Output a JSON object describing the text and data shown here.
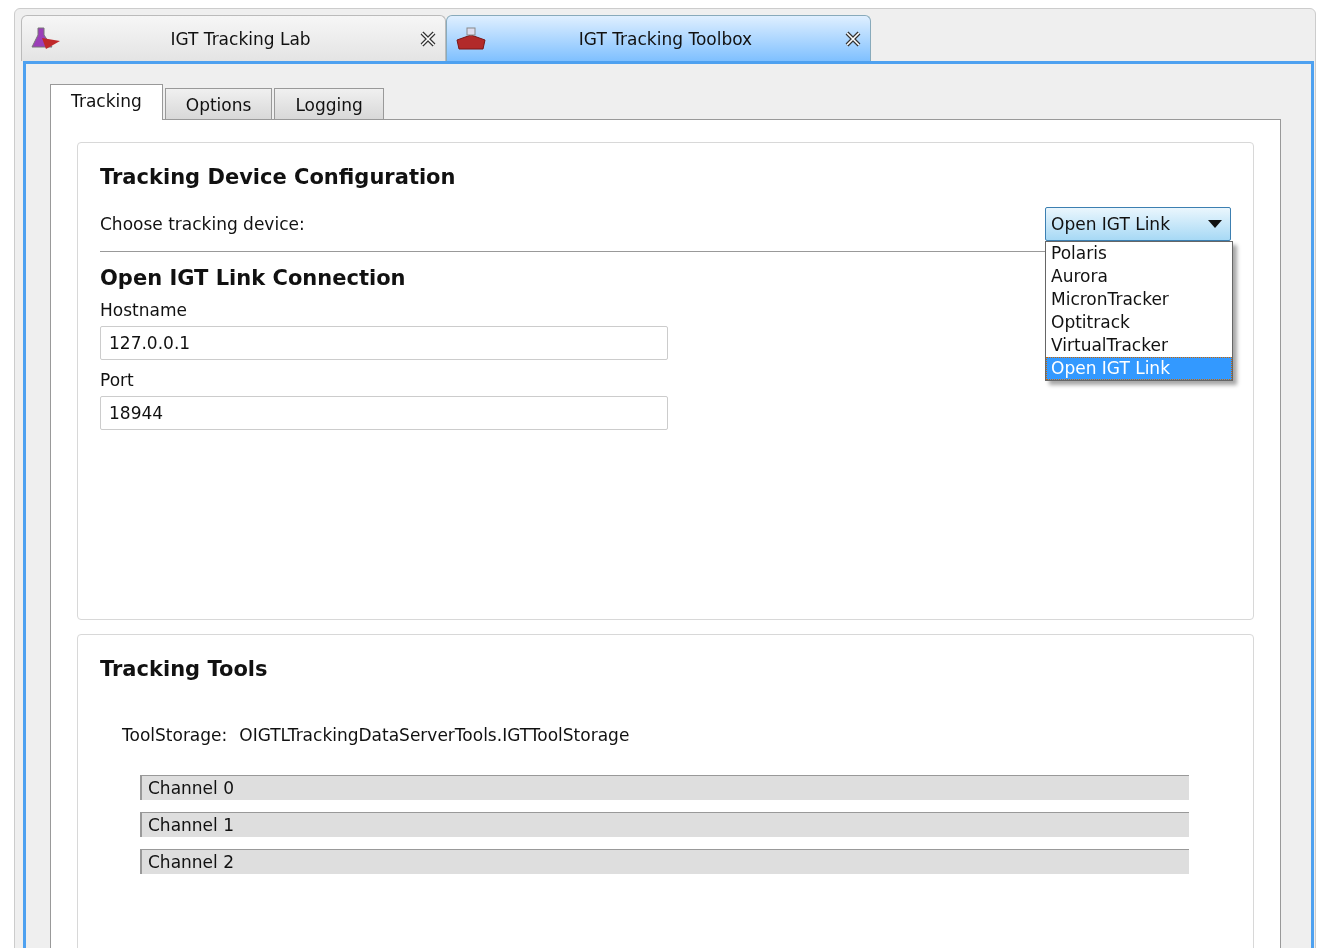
{
  "app_tabs": [
    {
      "label": "IGT Tracking Lab",
      "kind": "flask",
      "selected": false
    },
    {
      "label": "IGT Tracking Toolbox",
      "kind": "toolbox",
      "selected": true
    }
  ],
  "tabs": [
    {
      "label": "Tracking",
      "selected": true
    },
    {
      "label": "Options",
      "selected": false
    },
    {
      "label": "Logging",
      "selected": false
    }
  ],
  "device_config": {
    "title": "Tracking Device Configuration",
    "choose_label": "Choose tracking device:",
    "device_dropdown": {
      "value": "Open IGT Link",
      "expanded": true,
      "options": [
        {
          "label": "Polaris",
          "selected": false
        },
        {
          "label": "Aurora",
          "selected": false
        },
        {
          "label": "MicronTracker",
          "selected": false
        },
        {
          "label": "Optitrack",
          "selected": false
        },
        {
          "label": "VirtualTracker",
          "selected": false
        },
        {
          "label": "Open IGT Link",
          "selected": true
        }
      ]
    }
  },
  "connection": {
    "title": "Open IGT Link Connection",
    "fields": [
      {
        "label": "Hostname",
        "value": "127.0.0.1"
      },
      {
        "label": "Port",
        "value": "18944"
      }
    ]
  },
  "tools": {
    "title": "Tracking Tools",
    "storage_label": "ToolStorage:",
    "storage_value": "OIGTLTrackingDataServerTools.IGTToolStorage",
    "channels": [
      "Channel 0",
      "Channel 1",
      "Channel 2"
    ]
  }
}
